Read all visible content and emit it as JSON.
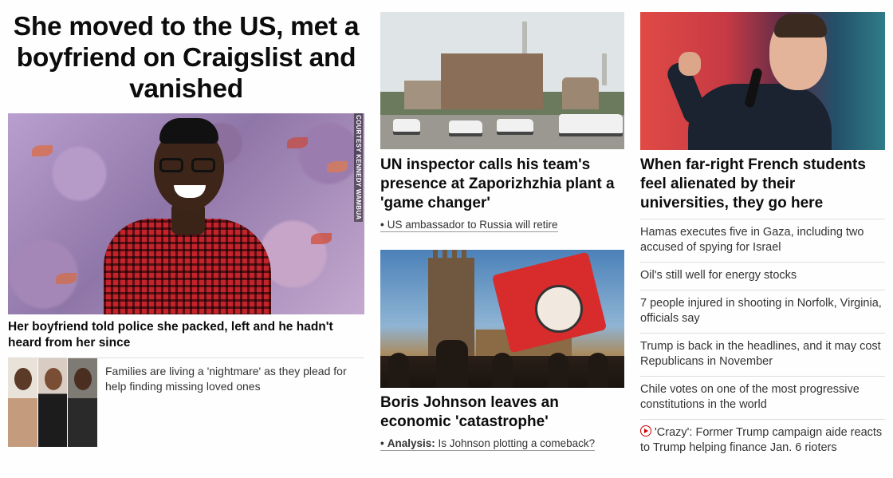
{
  "col1": {
    "headline": "She moved to the US, met a boyfriend on Craigslist and vanished",
    "photo_credit": "COURTESY KENNEDY WAMBUA",
    "caption": "Her boyfriend told police she packed, left and he hadn't heard from her since",
    "related": "Families are living a 'nightmare' as they plead for help finding missing loved ones"
  },
  "col2": {
    "story1": {
      "title": "UN inspector calls his team's presence at Zaporizhzhia plant a 'game changer'",
      "related": "US ambassador to Russia will retire"
    },
    "story2": {
      "title": "Boris Johnson leaves an economic 'catastrophe'",
      "related_prefix": "Analysis:",
      "related": "Is Johnson plotting a comeback?"
    }
  },
  "col3": {
    "title": "When far-right French students feel alienated by their universities, they go here",
    "list": [
      "Hamas executes five in Gaza, including two accused of spying for Israel",
      "Oil's still well for energy stocks",
      "7 people injured in shooting in Norfolk, Virginia, officials say",
      "Trump is back in the headlines, and it may cost Republicans in November",
      "Chile votes on one of the most progressive constitutions in the world",
      "'Crazy': Former Trump campaign aide reacts to Trump helping finance Jan. 6 rioters"
    ],
    "video_icon": "play-circle-icon"
  },
  "colors": {
    "accent_red": "#cc0000",
    "text": "#0c0c0c",
    "divider": "#dddddd"
  }
}
